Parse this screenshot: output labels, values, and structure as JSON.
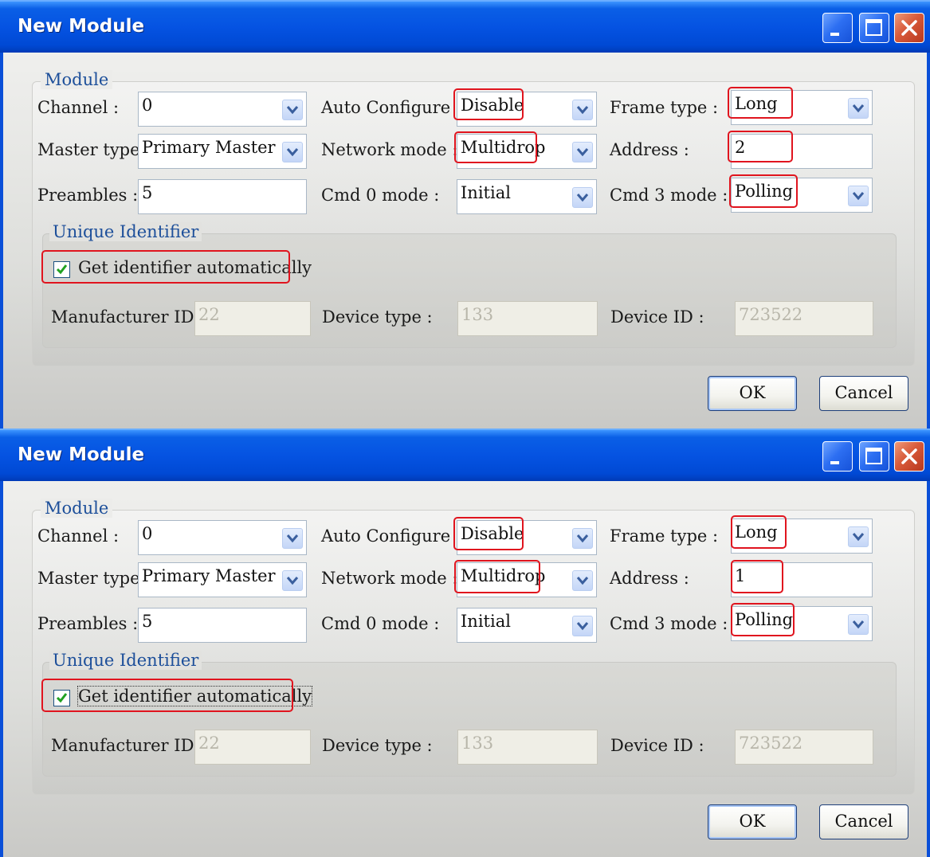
{
  "dialogs": [
    {
      "title": "New Module",
      "module_group_label": "Module",
      "channel_label": "Channel :",
      "channel_value": "0",
      "master_type_label": "Master type :",
      "master_type_value": "Primary Master",
      "preambles_label": "Preambles :",
      "preambles_value": "5",
      "auto_configure_label": "Auto Configure :",
      "auto_configure_value": "Disable",
      "network_mode_label": "Network mode :",
      "network_mode_value": "Multidrop",
      "cmd0_mode_label": "Cmd 0 mode :",
      "cmd0_mode_value": "Initial",
      "frame_type_label": "Frame type :",
      "frame_type_value": "Long",
      "address_label": "Address :",
      "address_value": "2",
      "cmd3_mode_label": "Cmd 3 mode :",
      "cmd3_mode_value": "Polling",
      "uid_group_label": "Unique Identifier",
      "get_identifier_label": "Get identifier automatically",
      "get_identifier_checked": true,
      "manufacturer_id_label": "Manufacturer ID :",
      "manufacturer_id_value": "22",
      "device_type_label": "Device type :",
      "device_type_value": "133",
      "device_id_label": "Device ID :",
      "device_id_value": "723522",
      "ok_label": "OK",
      "cancel_label": "Cancel"
    },
    {
      "title": "New Module",
      "module_group_label": "Module",
      "channel_label": "Channel :",
      "channel_value": "0",
      "master_type_label": "Master type :",
      "master_type_value": "Primary Master",
      "preambles_label": "Preambles :",
      "preambles_value": "5",
      "auto_configure_label": "Auto Configure :",
      "auto_configure_value": "Disable",
      "network_mode_label": "Network mode :",
      "network_mode_value": "Multidrop",
      "cmd0_mode_label": "Cmd 0 mode :",
      "cmd0_mode_value": "Initial",
      "frame_type_label": "Frame type :",
      "frame_type_value": "Long",
      "address_label": "Address :",
      "address_value": "1",
      "cmd3_mode_label": "Cmd 3 mode :",
      "cmd3_mode_value": "Polling",
      "uid_group_label": "Unique Identifier",
      "get_identifier_label": "Get identifier automatically",
      "get_identifier_checked": true,
      "manufacturer_id_label": "Manufacturer ID :",
      "manufacturer_id_value": "22",
      "device_type_label": "Device type :",
      "device_type_value": "133",
      "device_id_label": "Device ID :",
      "device_id_value": "723522",
      "ok_label": "OK",
      "cancel_label": "Cancel"
    }
  ],
  "icons": {
    "minimize": "minimize-icon",
    "maximize": "maximize-icon",
    "close": "close-icon",
    "dropdown": "chevron-down-icon",
    "check": "checkmark-icon"
  },
  "colors": {
    "titlebar": "#0553e2",
    "highlight": "#e0141e",
    "legend_text": "#1d4f9a",
    "checkmark": "#21a121"
  }
}
